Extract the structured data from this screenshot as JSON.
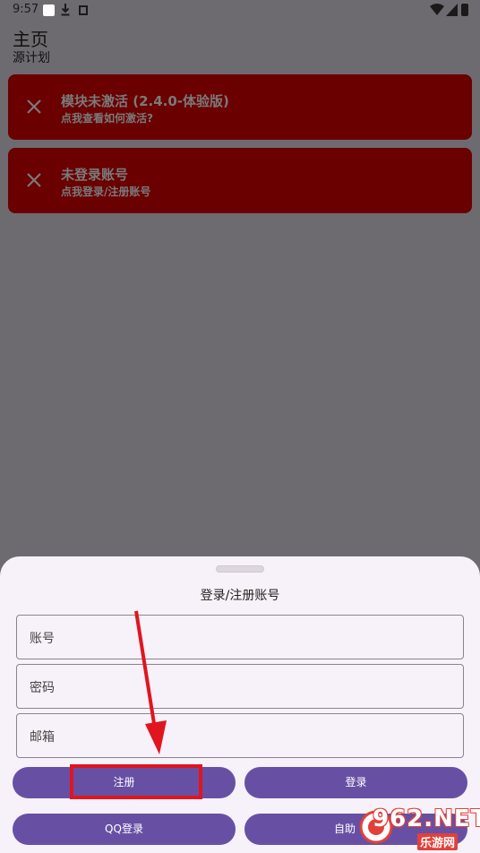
{
  "status_bar": {
    "time": "9:57",
    "icons": [
      "white-square-icon",
      "download-icon",
      "app-icon",
      "wifi-icon",
      "signal-icon",
      "battery-icon"
    ]
  },
  "header": {
    "title": "主页",
    "subtitle": "源计划"
  },
  "alerts": [
    {
      "title": "模块未激活 (2.4.0-体验版)",
      "subtitle": "点我查看如何激活?",
      "icon": "close-icon"
    },
    {
      "title": "未登录账号",
      "subtitle": "点我登录/注册账号",
      "icon": "close-icon"
    }
  ],
  "sheet": {
    "title": "登录/注册账号",
    "fields": {
      "account": {
        "placeholder": "账号",
        "value": ""
      },
      "password": {
        "placeholder": "密码",
        "value": ""
      },
      "email": {
        "placeholder": "邮箱",
        "value": ""
      }
    },
    "buttons": {
      "register": "注册",
      "login": "登录",
      "qq_login": "QQ登录",
      "self_help": "自助"
    }
  },
  "watermark": {
    "text": "962.NET",
    "sub": "乐游网"
  },
  "colors": {
    "alert_bg": "#6a0000",
    "button_bg": "#6750a4",
    "sheet_bg": "#f7f1f9",
    "highlight": "#e0151f",
    "overlay": "#6d6b70"
  }
}
